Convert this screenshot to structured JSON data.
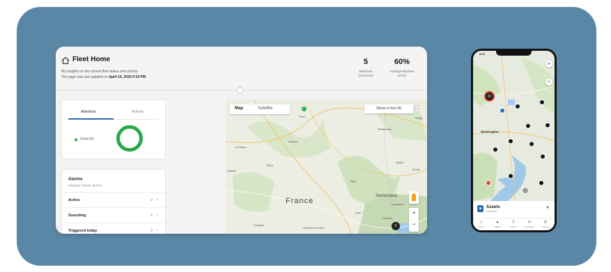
{
  "colors": {
    "frame": "#5b87a6",
    "accent": "#2e6ab2",
    "good": "#2aa84a"
  },
  "desktop": {
    "title": "Fleet Home",
    "subtitle_line1": "My insights on the current fleet status and activity.",
    "subtitle_line2_prefix": "The page was last updated on ",
    "subtitle_line2_date": "April 16, 2020 9:19 PM",
    "stats": [
      {
        "value": "5",
        "label_line1": "Machines",
        "label_line2": "Connected"
      },
      {
        "value": "60%",
        "label_line1": "Average Machine",
        "label_line2": "Score"
      }
    ],
    "tabs": [
      "Attention",
      "Activity"
    ],
    "legend": "Good (5)",
    "alarms": {
      "title": "Alarms",
      "subtitle": "Manager Classic alarms",
      "rows": [
        {
          "label": "Active",
          "value": "0"
        },
        {
          "label": "Sounding",
          "value": "0"
        },
        {
          "label": "Triggered today",
          "value": "0"
        }
      ]
    },
    "map": {
      "tab_map": "Map",
      "tab_satellite": "Satellite",
      "show_in_list": "Show in list (4)",
      "country_label": "France",
      "region_label": "Switzerland",
      "place_labels": [
        "Paris",
        "Strasbourg",
        "Basel",
        "Zurich",
        "Lyon",
        "Stuttg",
        "Dijon",
        "Geneva",
        "Lausanne",
        "Le Mans",
        "Nantes",
        "Tours",
        "Orléans",
        "Limoges",
        "Clermont-Ferrand"
      ],
      "cluster_count": "5"
    }
  },
  "phone": {
    "time": "9:41",
    "city_label": "Washington",
    "cluster_count": "22",
    "sheet_title": "Assets",
    "sheet_subtitle": "26 assets",
    "nav": [
      "Alerts",
      "Assets",
      "Search",
      "Messages",
      "Settings"
    ]
  }
}
